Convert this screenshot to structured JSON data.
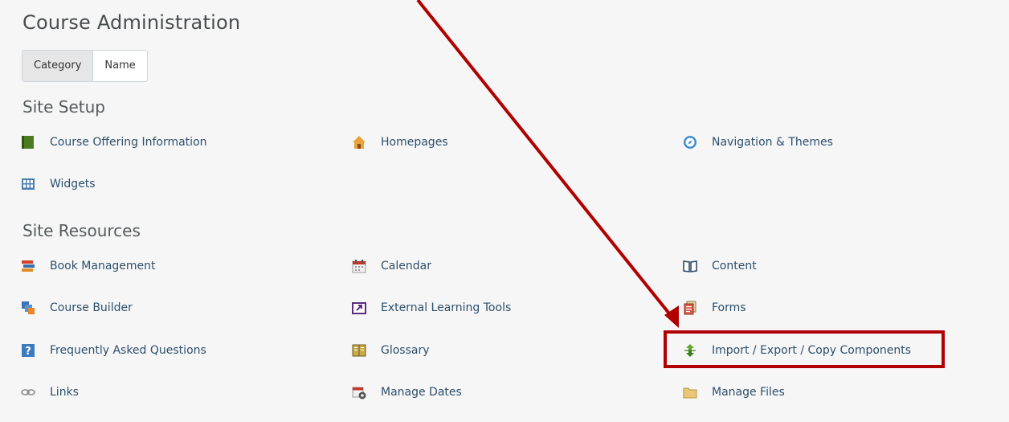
{
  "title": "Course Administration",
  "view_toggle": {
    "category_label": "Category",
    "name_label": "Name"
  },
  "sections": {
    "site_setup": {
      "heading": "Site Setup",
      "items": [
        {
          "label": "Course Offering Information",
          "icon": "book-icon"
        },
        {
          "label": "Homepages",
          "icon": "house-icon"
        },
        {
          "label": "Navigation & Themes",
          "icon": "compass-icon"
        },
        {
          "label": "Widgets",
          "icon": "widgets-icon"
        }
      ]
    },
    "site_resources": {
      "heading": "Site Resources",
      "items": [
        {
          "label": "Book Management",
          "icon": "books-icon"
        },
        {
          "label": "Calendar",
          "icon": "calendar-icon"
        },
        {
          "label": "Content",
          "icon": "open-book-icon"
        },
        {
          "label": "Course Builder",
          "icon": "blocks-icon"
        },
        {
          "label": "External Learning Tools",
          "icon": "external-tool-icon"
        },
        {
          "label": "Forms",
          "icon": "forms-icon"
        },
        {
          "label": "Frequently Asked Questions",
          "icon": "faq-icon"
        },
        {
          "label": "Glossary",
          "icon": "glossary-icon"
        },
        {
          "label": "Import / Export / Copy Components",
          "icon": "import-export-icon"
        },
        {
          "label": "Links",
          "icon": "link-icon"
        },
        {
          "label": "Manage Dates",
          "icon": "calendar-gear-icon"
        },
        {
          "label": "Manage Files",
          "icon": "folder-icon"
        }
      ]
    }
  },
  "colors": {
    "link": "#2d4f6c",
    "annotation": "#b00000",
    "background": "#f6f6f6"
  }
}
